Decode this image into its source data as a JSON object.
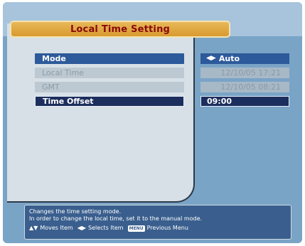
{
  "title": "Local Time Setting",
  "menu": [
    {
      "label": "Mode",
      "value": "Auto",
      "state": "active",
      "has_arrows": true
    },
    {
      "label": "Local Time",
      "value": "12/10/05 17:21",
      "state": "disabled",
      "has_arrows": false
    },
    {
      "label": "GMT",
      "value": "12/10/05 08:21",
      "state": "disabled",
      "has_arrows": false
    },
    {
      "label": "Time Offset",
      "value": "09:00",
      "state": "selected",
      "has_arrows": false
    }
  ],
  "help": {
    "line1": "Changes the time setting mode.",
    "line2": "In order to change the local time, set it to the manual mode.",
    "moves_label": "Moves Item",
    "selects_label": "Selects Item",
    "menu_key": "MENU",
    "previous_label": "Previous Menu"
  },
  "colors": {
    "title_bar": "#d99a2e",
    "title_text": "#8a0a0a",
    "active_row": "#2d5a9a",
    "selected_row": "#1c2e5e",
    "disabled_row": "#bcc9d3"
  }
}
